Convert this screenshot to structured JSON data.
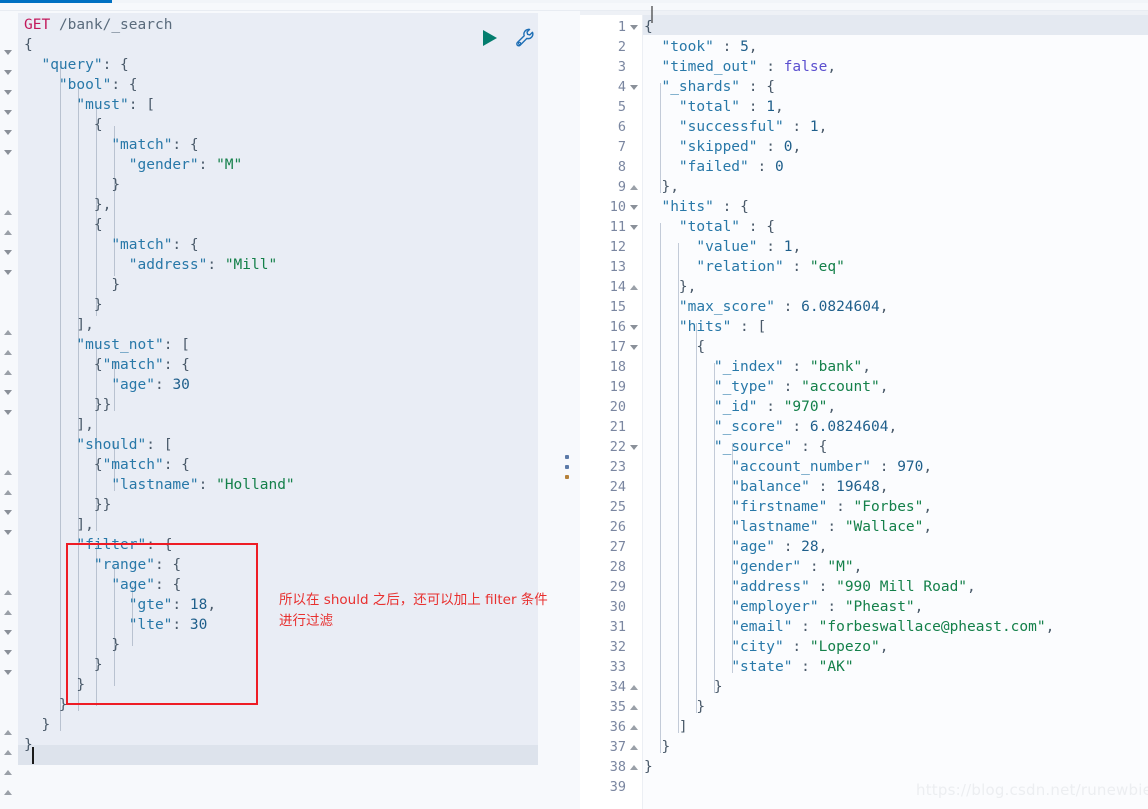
{
  "window": {
    "tab_accent_color": "#0071c2",
    "background": "#ffffff"
  },
  "request": {
    "method": "GET",
    "path": "/bank/_search",
    "run_button_title": "Click to send request",
    "wrench_button_title": "Open documentation / options",
    "body_lines": [
      "{",
      "  \"query\": {",
      "    \"bool\": {",
      "      \"must\": [",
      "        {",
      "          \"match\": {",
      "            \"gender\": \"M\"",
      "          }",
      "        },",
      "        {",
      "          \"match\": {",
      "            \"address\": \"Mill\"",
      "          }",
      "        }",
      "      ],",
      "      \"must_not\": [",
      "        {\"match\": {",
      "          \"age\": 30",
      "        }}",
      "      ],",
      "      \"should\": [",
      "        {\"match\": {",
      "          \"lastname\": \"Holland\"",
      "        }}",
      "      ],",
      "      \"filter\": {",
      "        \"range\": {",
      "          \"age\": {",
      "            \"gte\": 18,",
      "            \"lte\": 30",
      "          }",
      "        }",
      "      }",
      "    }",
      "  }",
      "}"
    ]
  },
  "annotation": {
    "color": "#ee1c25",
    "text_line1": "所以在 should 之后，还可以加上 filter 条件",
    "text_line2": "进行过滤"
  },
  "response": {
    "first_line_number": 1,
    "last_line_number": 39,
    "lines": [
      {
        "n": 1,
        "fold": "down",
        "text": "{"
      },
      {
        "n": 2,
        "fold": "",
        "text": "  \"took\" : 5,"
      },
      {
        "n": 3,
        "fold": "",
        "text": "  \"timed_out\" : false,"
      },
      {
        "n": 4,
        "fold": "down",
        "text": "  \"_shards\" : {"
      },
      {
        "n": 5,
        "fold": "",
        "text": "    \"total\" : 1,"
      },
      {
        "n": 6,
        "fold": "",
        "text": "    \"successful\" : 1,"
      },
      {
        "n": 7,
        "fold": "",
        "text": "    \"skipped\" : 0,"
      },
      {
        "n": 8,
        "fold": "",
        "text": "    \"failed\" : 0"
      },
      {
        "n": 9,
        "fold": "up",
        "text": "  },"
      },
      {
        "n": 10,
        "fold": "down",
        "text": "  \"hits\" : {"
      },
      {
        "n": 11,
        "fold": "down",
        "text": "    \"total\" : {"
      },
      {
        "n": 12,
        "fold": "",
        "text": "      \"value\" : 1,"
      },
      {
        "n": 13,
        "fold": "",
        "text": "      \"relation\" : \"eq\""
      },
      {
        "n": 14,
        "fold": "up",
        "text": "    },"
      },
      {
        "n": 15,
        "fold": "",
        "text": "    \"max_score\" : 6.0824604,"
      },
      {
        "n": 16,
        "fold": "down",
        "text": "    \"hits\" : ["
      },
      {
        "n": 17,
        "fold": "down",
        "text": "      {"
      },
      {
        "n": 18,
        "fold": "",
        "text": "        \"_index\" : \"bank\","
      },
      {
        "n": 19,
        "fold": "",
        "text": "        \"_type\" : \"account\","
      },
      {
        "n": 20,
        "fold": "",
        "text": "        \"_id\" : \"970\","
      },
      {
        "n": 21,
        "fold": "",
        "text": "        \"_score\" : 6.0824604,"
      },
      {
        "n": 22,
        "fold": "down",
        "text": "        \"_source\" : {"
      },
      {
        "n": 23,
        "fold": "",
        "text": "          \"account_number\" : 970,"
      },
      {
        "n": 24,
        "fold": "",
        "text": "          \"balance\" : 19648,"
      },
      {
        "n": 25,
        "fold": "",
        "text": "          \"firstname\" : \"Forbes\","
      },
      {
        "n": 26,
        "fold": "",
        "text": "          \"lastname\" : \"Wallace\","
      },
      {
        "n": 27,
        "fold": "",
        "text": "          \"age\" : 28,"
      },
      {
        "n": 28,
        "fold": "",
        "text": "          \"gender\" : \"M\","
      },
      {
        "n": 29,
        "fold": "",
        "text": "          \"address\" : \"990 Mill Road\","
      },
      {
        "n": 30,
        "fold": "",
        "text": "          \"employer\" : \"Pheast\","
      },
      {
        "n": 31,
        "fold": "",
        "text": "          \"email\" : \"forbeswallace@pheast.com\","
      },
      {
        "n": 32,
        "fold": "",
        "text": "          \"city\" : \"Lopezo\","
      },
      {
        "n": 33,
        "fold": "",
        "text": "          \"state\" : \"AK\""
      },
      {
        "n": 34,
        "fold": "up",
        "text": "        }"
      },
      {
        "n": 35,
        "fold": "up",
        "text": "      }"
      },
      {
        "n": 36,
        "fold": "up",
        "text": "    ]"
      },
      {
        "n": 37,
        "fold": "up",
        "text": "  }"
      },
      {
        "n": 38,
        "fold": "up",
        "text": "}"
      },
      {
        "n": 39,
        "fold": "",
        "text": ""
      }
    ]
  },
  "watermark": {
    "text": "https://blog.csdn.net/runewbie"
  }
}
